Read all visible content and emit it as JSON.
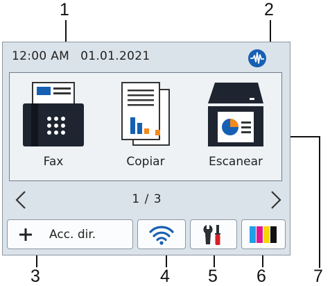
{
  "callouts": [
    "1",
    "2",
    "3",
    "4",
    "5",
    "6",
    "7"
  ],
  "status_bar": {
    "time": "12:00 AM",
    "date": "01.01.2021",
    "network_icon": "network-pulse-icon"
  },
  "tiles": [
    {
      "label": "Fax",
      "icon": "fax-icon"
    },
    {
      "label": "Copiar",
      "icon": "copy-icon"
    },
    {
      "label": "Escanear",
      "icon": "scanner-icon"
    }
  ],
  "pager": {
    "text": "1 / 3",
    "prev_icon": "chevron-left-icon",
    "next_icon": "chevron-right-icon"
  },
  "bottom_buttons": {
    "shortcut_label": "Acc. dir.",
    "shortcut_icon": "plus-icon",
    "wifi_icon": "wifi-icon",
    "settings_icon": "tools-icon",
    "ink_icon": "ink-cartridges-icon"
  },
  "colors": {
    "screen_bg": "#dbe3ea",
    "panel_bg": "#eef2f5",
    "accent_blue": "#1660b4",
    "ink_cyan": "#1f9fe8",
    "ink_magenta": "#e0188c",
    "ink_yellow": "#f5d800",
    "ink_black": "#111111"
  }
}
